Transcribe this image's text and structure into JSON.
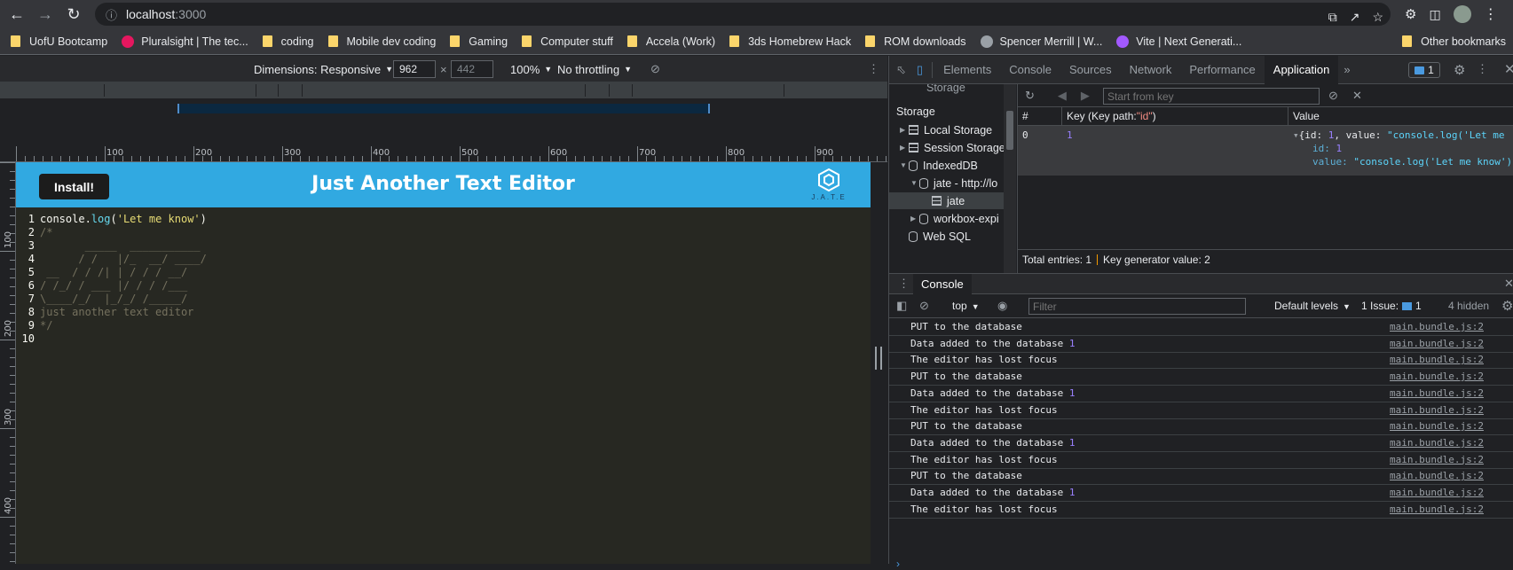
{
  "browser": {
    "url_host": "localhost",
    "url_port": ":3000",
    "bookmarks": [
      {
        "label": "UofU Bootcamp",
        "type": "folder"
      },
      {
        "label": "Pluralsight | The tec...",
        "type": "site",
        "color": "#e5175f"
      },
      {
        "label": "coding",
        "type": "folder"
      },
      {
        "label": "Mobile dev coding",
        "type": "folder"
      },
      {
        "label": "Gaming",
        "type": "folder"
      },
      {
        "label": "Computer stuff",
        "type": "folder"
      },
      {
        "label": "Accela (Work)",
        "type": "folder"
      },
      {
        "label": "3ds Homebrew Hack",
        "type": "folder"
      },
      {
        "label": "ROM downloads",
        "type": "folder"
      },
      {
        "label": "Spencer Merrill | W...",
        "type": "site",
        "color": "#9aa0a6"
      },
      {
        "label": "Vite | Next Generati...",
        "type": "site",
        "color": "#a259ff"
      }
    ],
    "other_bookmarks": "Other bookmarks"
  },
  "device_toolbar": {
    "dimensions_label": "Dimensions: Responsive",
    "width": "962",
    "height_placeholder": "442",
    "zoom": "100%",
    "throttling": "No throttling"
  },
  "rulers": {
    "h_ticks": [
      "100",
      "200",
      "300",
      "400",
      "500",
      "600",
      "700",
      "800",
      "900"
    ],
    "v_ticks": [
      "100",
      "200",
      "300",
      "400"
    ]
  },
  "app": {
    "install_label": "Install!",
    "title": "Just Another Text Editor",
    "logo_text": "J.A.T.E",
    "lines": [
      {
        "num": "1",
        "kind": "code",
        "text": "console.log('Let me know')"
      },
      {
        "num": "2",
        "kind": "comment",
        "text": "/*"
      },
      {
        "num": "3",
        "kind": "comment",
        "text": "       _____  ___________"
      },
      {
        "num": "4",
        "kind": "comment",
        "text": "      / /   |/_  __/ ____/"
      },
      {
        "num": "5",
        "kind": "comment",
        "text": " __  / / /| | / / / __/"
      },
      {
        "num": "6",
        "kind": "comment",
        "text": "/ /_/ / ___ |/ / / /___"
      },
      {
        "num": "7",
        "kind": "comment",
        "text": "\\____/_/  |_/_/ /_____/"
      },
      {
        "num": "8",
        "kind": "comment",
        "text": "just another text editor"
      },
      {
        "num": "9",
        "kind": "comment",
        "text": "*/"
      },
      {
        "num": "10",
        "kind": "code",
        "text": ""
      }
    ]
  },
  "devtools": {
    "tabs": [
      "Elements",
      "Console",
      "Sources",
      "Network",
      "Performance",
      "Application"
    ],
    "active_tab": "Application",
    "issues_count": "1",
    "sidebar": {
      "storage_top": "Storage",
      "storage_header": "Storage",
      "items": [
        "Local Storage",
        "Session Storage",
        "IndexedDB",
        "jate - http://lo",
        "jate",
        "workbox-expi",
        "Web SQL"
      ]
    },
    "idb": {
      "filter_placeholder": "Start from key",
      "col_hash": "#",
      "col_key_prefix": "Key (Key path: ",
      "col_key_path": "\"id\"",
      "col_key_suffix": ")",
      "col_value": "Value",
      "row_index": "0",
      "row_key": "1",
      "value_summary_a": "{id: ",
      "value_summary_b": "1",
      "value_summary_c": ", value: ",
      "value_summary_d": "\"console.log('Let me",
      "value_id_label": "id: ",
      "value_id": "1",
      "value_value_label": "value: ",
      "value_value": "\"console.log('Let me know')\"",
      "footer_entries": "Total entries: 1",
      "footer_keygen": "Key generator value: 2"
    },
    "drawer_tab": "Console",
    "console_toolbar": {
      "context": "top",
      "filter_placeholder": "Filter",
      "levels": "Default levels",
      "issues_label": "1 Issue:",
      "issues_count": "1",
      "hidden": "4 hidden"
    },
    "logs": [
      {
        "text": "PUT to the database",
        "num": "",
        "src": "main.bundle.js:2"
      },
      {
        "text": "Data added to the database ",
        "num": "1",
        "src": "main.bundle.js:2"
      },
      {
        "text": "The editor has lost focus",
        "num": "",
        "src": "main.bundle.js:2"
      },
      {
        "text": "PUT to the database",
        "num": "",
        "src": "main.bundle.js:2"
      },
      {
        "text": "Data added to the database ",
        "num": "1",
        "src": "main.bundle.js:2"
      },
      {
        "text": "The editor has lost focus",
        "num": "",
        "src": "main.bundle.js:2"
      },
      {
        "text": "PUT to the database",
        "num": "",
        "src": "main.bundle.js:2"
      },
      {
        "text": "Data added to the database ",
        "num": "1",
        "src": "main.bundle.js:2"
      },
      {
        "text": "The editor has lost focus",
        "num": "",
        "src": "main.bundle.js:2"
      },
      {
        "text": "PUT to the database",
        "num": "",
        "src": "main.bundle.js:2"
      },
      {
        "text": "Data added to the database ",
        "num": "1",
        "src": "main.bundle.js:2"
      },
      {
        "text": "The editor has lost focus",
        "num": "",
        "src": "main.bundle.js:2"
      }
    ],
    "prompt_glyph": "›"
  }
}
